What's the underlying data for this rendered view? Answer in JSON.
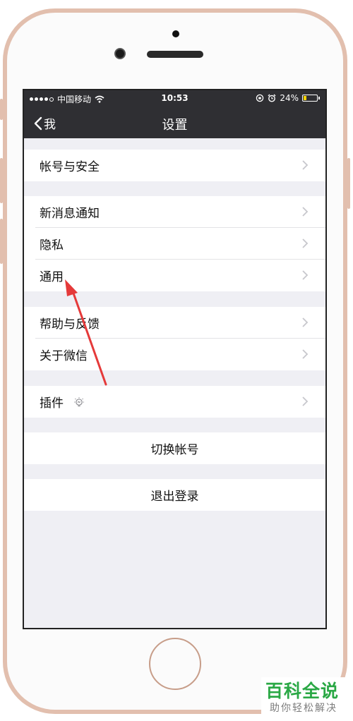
{
  "statusbar": {
    "carrier": "中国移动",
    "time": "10:53",
    "battery": "24%",
    "battery_level": 0.24
  },
  "navbar": {
    "back_label": "我",
    "title": "设置"
  },
  "groups": [
    {
      "items": [
        "帐号与安全"
      ]
    },
    {
      "items": [
        "新消息通知",
        "隐私",
        "通用"
      ]
    },
    {
      "items": [
        "帮助与反馈",
        "关于微信"
      ]
    },
    {
      "items": [
        "插件"
      ]
    }
  ],
  "actions": {
    "switch_account": "切换帐号",
    "logout": "退出登录"
  },
  "watermark": {
    "title": "百科全说",
    "subtitle": "助你轻松解决"
  },
  "colors": {
    "nav_bg": "#2f2f33",
    "arrow": "#e53a3a",
    "brand": "#2aa845"
  }
}
